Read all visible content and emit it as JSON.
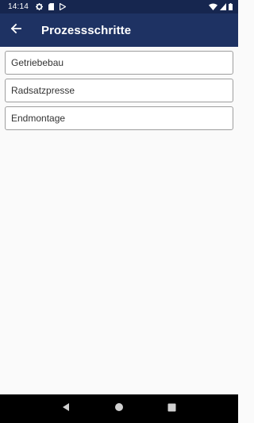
{
  "status_bar": {
    "time": "14:14",
    "icons": [
      "gear-icon",
      "sd-card-icon",
      "play-store-icon",
      "wifi-icon",
      "signal-icon",
      "battery-icon"
    ]
  },
  "app_bar": {
    "back_icon": "arrow-back-icon",
    "title": "Prozessschritte"
  },
  "list": {
    "items": [
      {
        "label": "Getriebebau"
      },
      {
        "label": "Radsatzpresse"
      },
      {
        "label": "Endmontage"
      }
    ]
  },
  "nav_bar": {
    "icons": [
      "back-triangle-icon",
      "home-circle-icon",
      "recents-square-icon"
    ]
  },
  "colors": {
    "status_bar_bg": "#16264f",
    "app_bar_bg": "#1e3263",
    "background": "#fafafa",
    "item_border": "#9e9e9e"
  }
}
